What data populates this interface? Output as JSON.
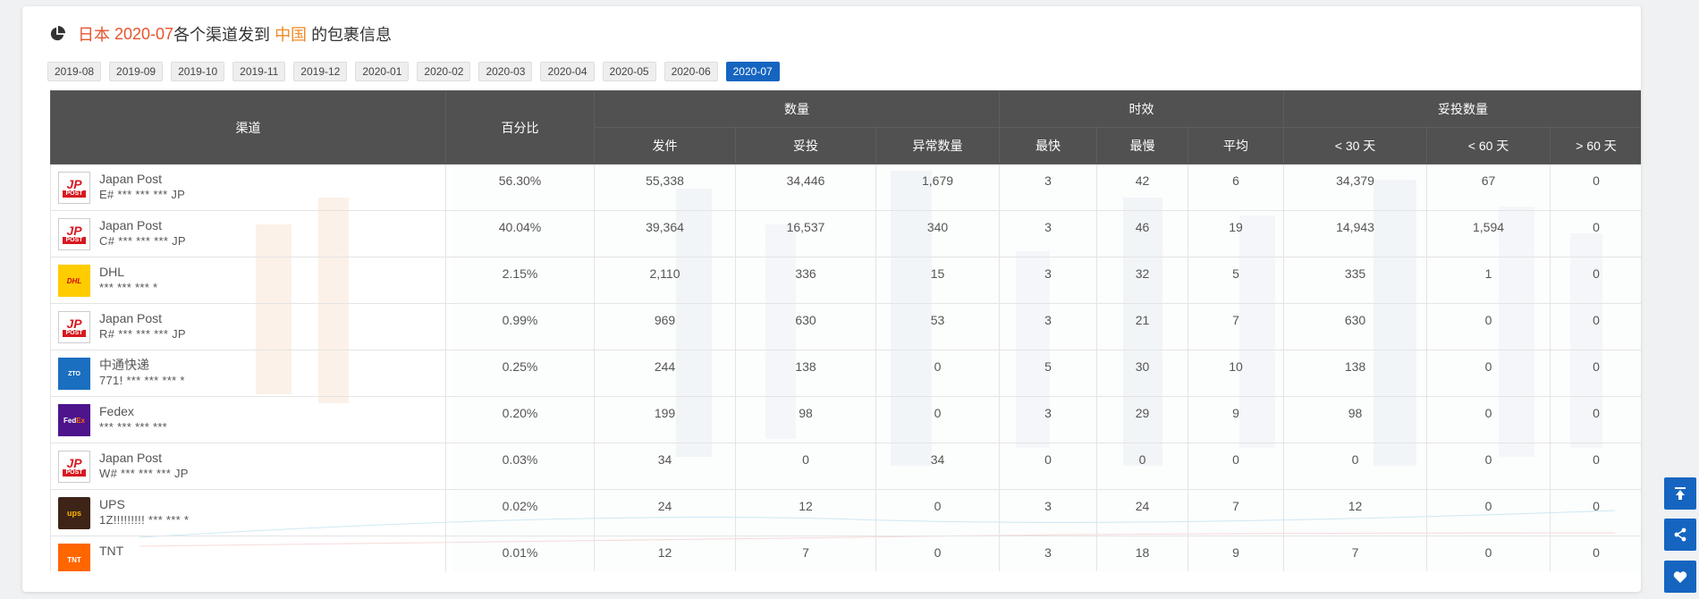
{
  "title": {
    "origin": "日本",
    "month": "2020-07",
    "text_mid": "各个渠道发到",
    "dest": "中国",
    "text_end": "的包裹信息"
  },
  "months": [
    "2019-08",
    "2019-09",
    "2019-10",
    "2019-11",
    "2019-12",
    "2020-01",
    "2020-02",
    "2020-03",
    "2020-04",
    "2020-05",
    "2020-06",
    "2020-07"
  ],
  "active_month": "2020-07",
  "table": {
    "headers": {
      "channel": "渠道",
      "percent": "百分比",
      "qty_group": "数量",
      "shipped": "发件",
      "delivered": "妥投",
      "abnormal": "异常数量",
      "time_group": "时效",
      "fastest": "最快",
      "slowest": "最慢",
      "average": "平均",
      "dq_group": "妥投数量",
      "lt30": "< 30 天",
      "lt60": "< 60 天",
      "gt60": "> 60 天"
    },
    "rows": [
      {
        "name": "Japan Post",
        "number": "E# *** *** *** JP",
        "logo": "japan-post",
        "percent": "56.30%",
        "shipped": "55,338",
        "delivered": "34,446",
        "abnormal": "1,679",
        "fastest": "3",
        "slowest": "42",
        "average": "6",
        "lt30": "34,379",
        "lt60": "67",
        "gt60": "0"
      },
      {
        "name": "Japan Post",
        "number": "C# *** *** *** JP",
        "logo": "japan-post",
        "percent": "40.04%",
        "shipped": "39,364",
        "delivered": "16,537",
        "abnormal": "340",
        "fastest": "3",
        "slowest": "46",
        "average": "19",
        "lt30": "14,943",
        "lt60": "1,594",
        "gt60": "0"
      },
      {
        "name": "DHL",
        "number": "*** *** *** *",
        "logo": "dhl",
        "percent": "2.15%",
        "shipped": "2,110",
        "delivered": "336",
        "abnormal": "15",
        "fastest": "3",
        "slowest": "32",
        "average": "5",
        "lt30": "335",
        "lt60": "1",
        "gt60": "0"
      },
      {
        "name": "Japan Post",
        "number": "R# *** *** *** JP",
        "logo": "japan-post",
        "percent": "0.99%",
        "shipped": "969",
        "delivered": "630",
        "abnormal": "53",
        "fastest": "3",
        "slowest": "21",
        "average": "7",
        "lt30": "630",
        "lt60": "0",
        "gt60": "0"
      },
      {
        "name": "中通快递",
        "number": "771! *** *** *** *",
        "logo": "zto",
        "percent": "0.25%",
        "shipped": "244",
        "delivered": "138",
        "abnormal": "0",
        "fastest": "5",
        "slowest": "30",
        "average": "10",
        "lt30": "138",
        "lt60": "0",
        "gt60": "0"
      },
      {
        "name": "Fedex",
        "number": "*** *** *** ***",
        "logo": "fedex",
        "percent": "0.20%",
        "shipped": "199",
        "delivered": "98",
        "abnormal": "0",
        "fastest": "3",
        "slowest": "29",
        "average": "9",
        "lt30": "98",
        "lt60": "0",
        "gt60": "0"
      },
      {
        "name": "Japan Post",
        "number": "W# *** *** *** JP",
        "logo": "japan-post",
        "percent": "0.03%",
        "shipped": "34",
        "delivered": "0",
        "abnormal": "34",
        "fastest": "0",
        "slowest": "0",
        "average": "0",
        "lt30": "0",
        "lt60": "0",
        "gt60": "0"
      },
      {
        "name": "UPS",
        "number": "1Z!!!!!!!!! *** *** *",
        "logo": "ups",
        "percent": "0.02%",
        "shipped": "24",
        "delivered": "12",
        "abnormal": "0",
        "fastest": "3",
        "slowest": "24",
        "average": "7",
        "lt30": "12",
        "lt60": "0",
        "gt60": "0"
      },
      {
        "name": "TNT",
        "number": "",
        "logo": "tnt",
        "percent": "0.01%",
        "shipped": "12",
        "delivered": "7",
        "abnormal": "0",
        "fastest": "3",
        "slowest": "18",
        "average": "9",
        "lt30": "7",
        "lt60": "0",
        "gt60": "0"
      }
    ]
  },
  "logo_text": {
    "japan_post_mark": "JP",
    "japan_post_word": "POST",
    "dhl": "DHL",
    "zto": "ZTO",
    "fedex_fed": "Fed",
    "fedex_ex": "Ex",
    "ups": "ups",
    "tnt": "TNT"
  },
  "icons": {
    "title": "pie-chart-icon",
    "side": [
      "arrow-up-to-top-icon",
      "share-icon",
      "heart-icon"
    ]
  },
  "colors": {
    "accent": "#1565c0",
    "highlight_orange": "#f08a24",
    "highlight_red": "#e8542f",
    "header_bg": "#484848"
  }
}
